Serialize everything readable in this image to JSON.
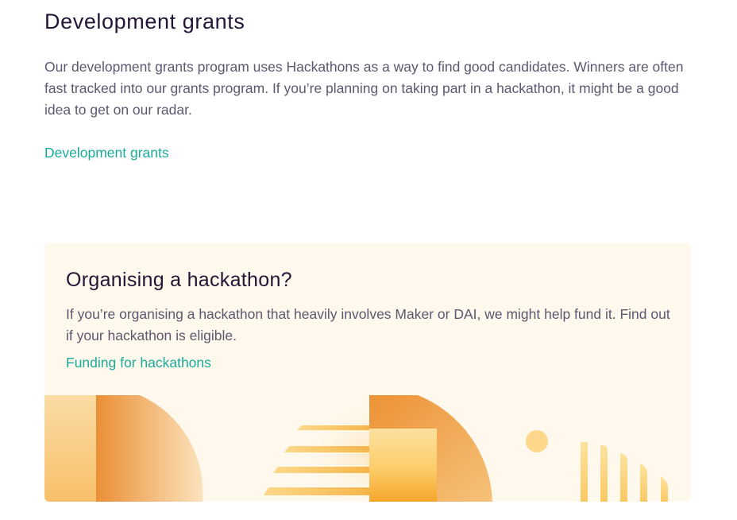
{
  "development": {
    "title": "Development grants",
    "body": "Our development grants program uses Hackathons as a way to find good candidates. Winners are often fast tracked into our grants program. If you’re planning on taking part in a hackathon, it might be a good idea to get on our radar.",
    "link_label": "Development grants"
  },
  "hackathon_card": {
    "title": "Organising a hackathon?",
    "body": "If you’re organising a hackathon that heavily involves Maker or DAI, we might help fund it. Find out if your hackathon is eligible.",
    "link_label": "Funding for hackathons"
  },
  "colors": {
    "heading": "#231536",
    "body_text": "#5b5870",
    "link": "#1aab9b",
    "card_background": "#fff8ec",
    "illustration_orange": "#ec9235",
    "illustration_yellow": "#fdcf6b"
  }
}
